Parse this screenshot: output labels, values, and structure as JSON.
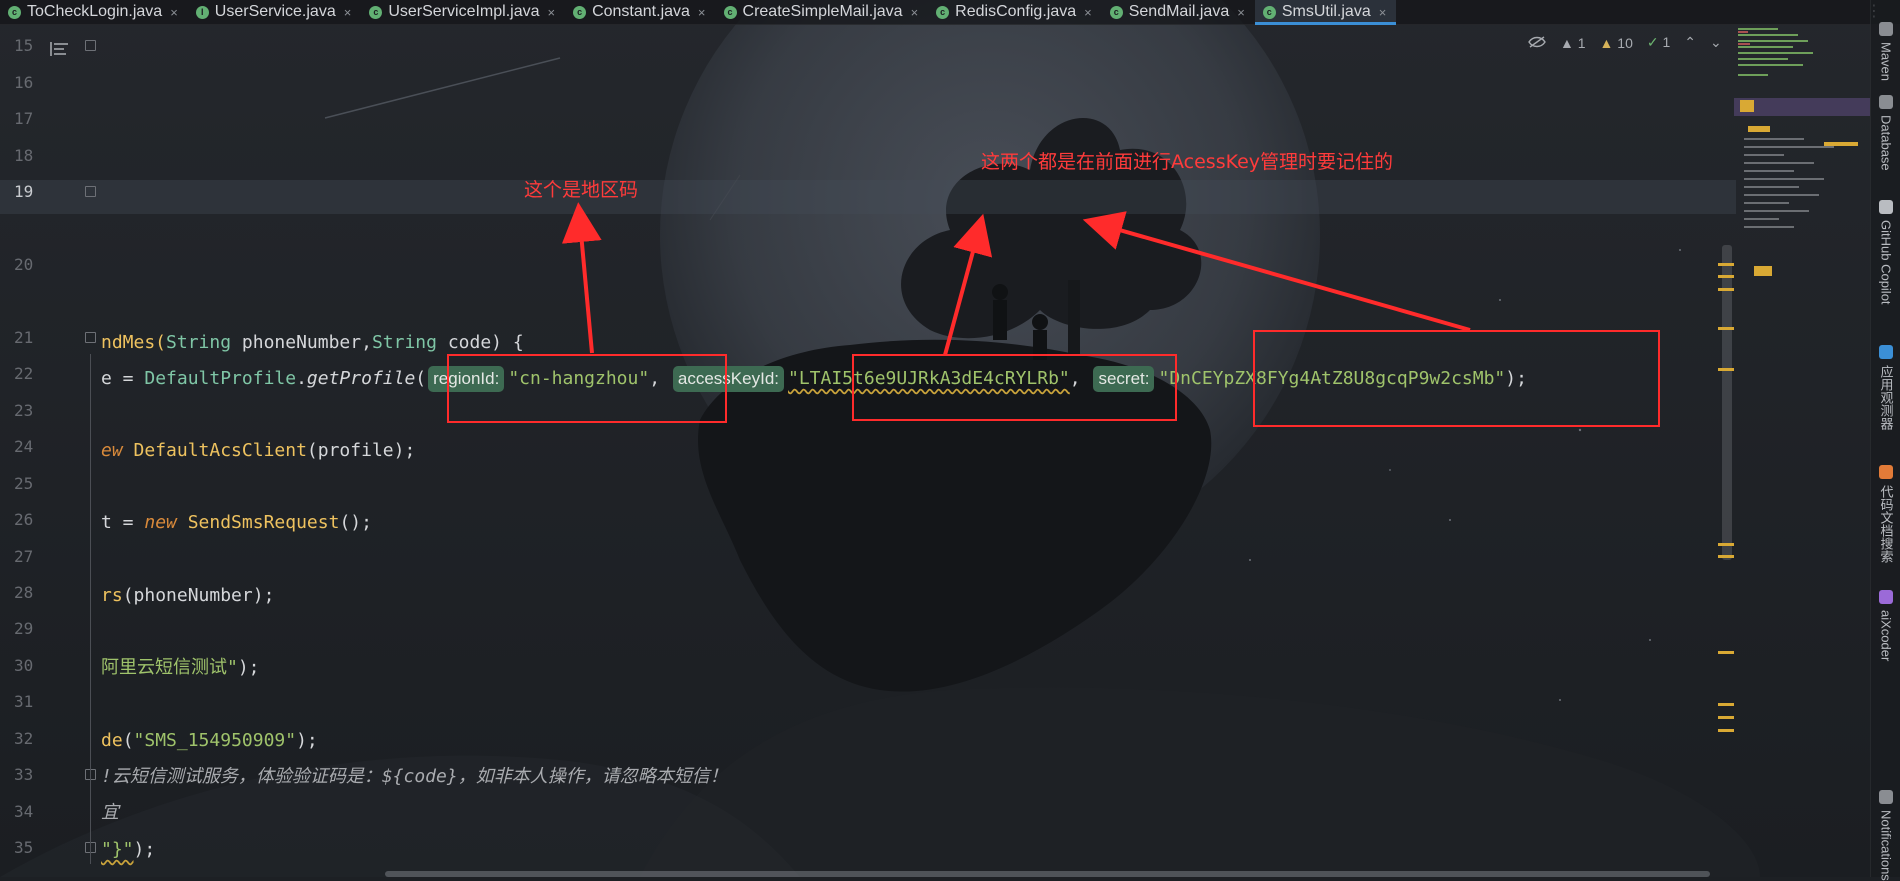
{
  "tabs": [
    {
      "label": "ToCheckLogin.java",
      "kind": "class"
    },
    {
      "label": "UserService.java",
      "kind": "interface"
    },
    {
      "label": "UserServiceImpl.java",
      "kind": "class"
    },
    {
      "label": "Constant.java",
      "kind": "class"
    },
    {
      "label": "CreateSimpleMail.java",
      "kind": "class"
    },
    {
      "label": "RedisConfig.java",
      "kind": "class"
    },
    {
      "label": "SendMail.java",
      "kind": "class"
    },
    {
      "label": "SmsUtil.java",
      "kind": "class",
      "active": true
    }
  ],
  "tab_close_glyph": "×",
  "tab_icon_class": "c",
  "tab_icon_interface": "I",
  "tabbar_menu_glyph": "⋮",
  "line_numbers": [
    "15",
    "16",
    "17",
    "18",
    "19",
    "20",
    "21",
    "22",
    "23",
    "24",
    "25",
    "26",
    "27",
    "28",
    "29",
    "30",
    "31",
    "32",
    "33",
    "34",
    "35"
  ],
  "current_line": "19",
  "code": {
    "line21": {
      "prefix": "ndMes(",
      "type1": "String",
      "mid": " phoneNumber,",
      "type2": "String",
      "suffix": " code) {"
    },
    "line22": {
      "lhs": "e = ",
      "cls": "DefaultProfile",
      "dot": ".",
      "method": "getProfile",
      "open": "(",
      "hint1": "regionId:",
      "region": "\"cn-hangzhou\"",
      "comma1": ",",
      "hint2": "accessKeyId:",
      "access_key": "\"LTAI5t6e9UJRkA3dE4cRYLRb\"",
      "comma2": ",",
      "hint3": "secret:",
      "secret": "\"DnCEYpZX8FYg4AtZ8U8gcqP9w2csMb\"",
      "close": ");"
    },
    "line24": {
      "kw": "ew",
      "cls": " DefaultAcsClient",
      "rest": "(profile);"
    },
    "line26": {
      "lhs": "t = ",
      "kw": "new",
      "cls": " SendSmsRequest",
      "rest": "();"
    },
    "line28": {
      "fn": "rs",
      "rest": "(phoneNumber);"
    },
    "line30": {
      "str": "阿里云短信测试\"",
      "rest": ");"
    },
    "line32": {
      "fn": "de",
      "open": "(",
      "str": "\"SMS_154950909\"",
      "rest": ");"
    },
    "line33": {
      "text": "!云短信测试服务，体验验证码是：${code}，如非本人操作，请忽略本短信！"
    },
    "line34": {
      "text": "宜"
    },
    "line35": {
      "str": "\"}\"",
      "rest": ");"
    }
  },
  "annotations": {
    "region_note": "这个是地区码",
    "keys_note": "这两个都是在前面进行AcessKey管理时要记住的"
  },
  "inspections": {
    "errors": "1",
    "warnings": "10",
    "weak": "1",
    "up": "⌃",
    "down": "⌄"
  },
  "right_tools": [
    {
      "label": "Maven",
      "icon": "maven-icon",
      "color": "#8a8d92"
    },
    {
      "label": "Database",
      "icon": "database-icon",
      "color": "#8a8d92"
    },
    {
      "label": "GitHub Copilot",
      "icon": "copilot-icon",
      "color": "#b9bcc1"
    },
    {
      "label": "应用观测器",
      "icon": "observer-icon",
      "color": "#3b8fd6"
    },
    {
      "label": "代码文档搜索",
      "icon": "doc-search-icon",
      "color": "#e27b38"
    },
    {
      "label": "aiXcoder",
      "icon": "aixcoder-icon",
      "color": "#9b6ad8"
    },
    {
      "label": "Notifications",
      "icon": "bell-icon",
      "color": "#8a8d92"
    }
  ],
  "colors": {
    "annotation": "#ff3b3b",
    "accent": "#3b8fd6",
    "hint_bg": "#3d6a52"
  }
}
